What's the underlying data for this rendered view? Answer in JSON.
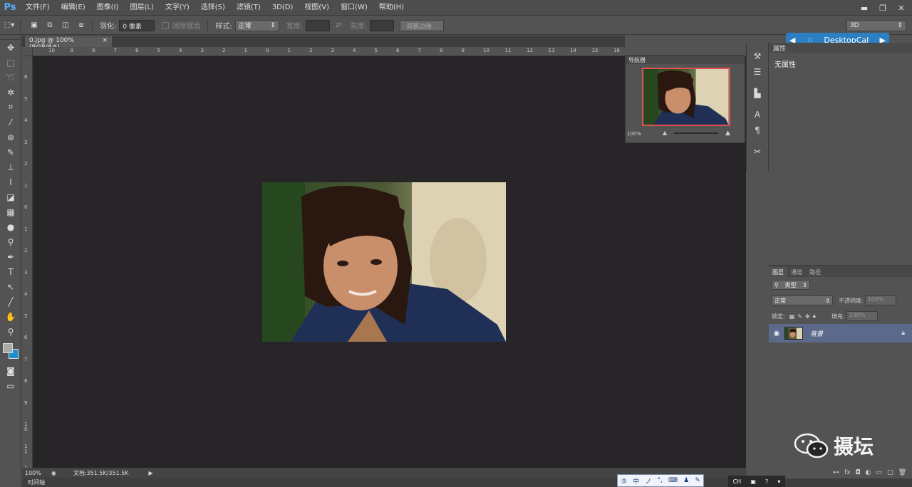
{
  "app": {
    "logo": "Ps",
    "menu": [
      "文件(F)",
      "编辑(E)",
      "图像(I)",
      "图层(L)",
      "文字(Y)",
      "选择(S)",
      "滤镜(T)",
      "3D(D)",
      "视图(V)",
      "窗口(W)",
      "帮助(H)"
    ]
  },
  "options": {
    "feather_label": "羽化:",
    "feather_value": "0 像素",
    "antialias_label": "消除锯齿",
    "style_label": "样式:",
    "style_value": "正常",
    "width_label": "宽度:",
    "height_label": "高度:",
    "refine_button": "调整边缘...",
    "workspace": "3D"
  },
  "document": {
    "tab_title": "0.jpg @ 100%(RGB/8#)",
    "tab_close": "×",
    "zoom": "100%",
    "doc_info": "文档:351.5K/351.5K",
    "ruler_top": [
      "10",
      "9",
      "8",
      "7",
      "6",
      "5",
      "4",
      "3",
      "2",
      "1",
      "0",
      "1",
      "2",
      "3",
      "4",
      "5",
      "6",
      "7",
      "8",
      "9",
      "10",
      "11",
      "12",
      "13",
      "14",
      "15",
      "16"
    ],
    "ruler_left": [
      "6",
      "5",
      "4",
      "3",
      "2",
      "1",
      "0",
      "1",
      "2",
      "3",
      "4",
      "5",
      "6",
      "7",
      "8",
      "9",
      "1 0",
      "1 1",
      "1 2",
      "1 3"
    ]
  },
  "navigator": {
    "title": "导航器",
    "zoom": "100%"
  },
  "desktopcal": {
    "label": "DesktopCal"
  },
  "properties": {
    "title": "属性",
    "content": "无属性"
  },
  "layers": {
    "tabs": [
      "图层",
      "通道",
      "路径"
    ],
    "filter_label": "类型",
    "blend_mode": "正常",
    "opacity_label": "不透明度:",
    "opacity_value": "100%",
    "lock_label": "锁定:",
    "fill_label": "填充:",
    "fill_value": "100%",
    "layer_name": "背景"
  },
  "statusbar": {
    "timeline": "时间轴"
  },
  "ime": {
    "items": [
      "中",
      "ノ",
      "°,",
      "⌨",
      "♟",
      "✎"
    ],
    "tray": [
      "CH"
    ]
  },
  "watermark": {
    "text": "摄坛"
  }
}
